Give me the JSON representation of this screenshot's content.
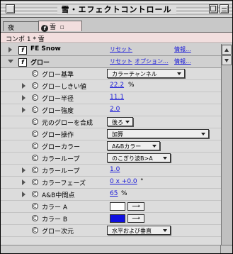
{
  "window": {
    "title": "雪・エフェクトコントロール"
  },
  "tabs": [
    {
      "label": "夜"
    },
    {
      "label": "雪"
    }
  ],
  "composition_line": "コンポ 1 * 雪",
  "effects": [
    {
      "name": "FE Snow",
      "reset": "リセット",
      "about": "情報..."
    },
    {
      "name": "グロー",
      "reset": "リセット",
      "options": "オプション...",
      "about": "情報..."
    }
  ],
  "properties": [
    {
      "label": "グロー基準",
      "dropdown": "カラーチャンネル"
    },
    {
      "label": "グローしきい値",
      "value": "22.2",
      "unit": "%"
    },
    {
      "label": "グロー半径",
      "value": "11.1"
    },
    {
      "label": "グロー強度",
      "value": "2.0"
    },
    {
      "label": "元のグローを合成",
      "dropdown": "後ろ"
    },
    {
      "label": "グロー操作",
      "dropdown": "加算"
    },
    {
      "label": "グローカラー",
      "dropdown": "A&Bカラー"
    },
    {
      "label": "カラーループ",
      "dropdown": "のこぎり波B>A"
    },
    {
      "label": "カラーループ",
      "value": "1.0"
    },
    {
      "label": "カラーフェーズ",
      "value": "0 x +0.0",
      "unit": "°"
    },
    {
      "label": "A&B中間点",
      "value": "65",
      "unit": "%"
    },
    {
      "label": "カラー A",
      "color": "#ffffff"
    },
    {
      "label": "カラー B",
      "color": "#1010e0"
    },
    {
      "label": "グロー次元",
      "dropdown": "水平および垂直"
    }
  ],
  "colors": {
    "link": "#1a1ad8",
    "tab_active": "#f2dede"
  }
}
